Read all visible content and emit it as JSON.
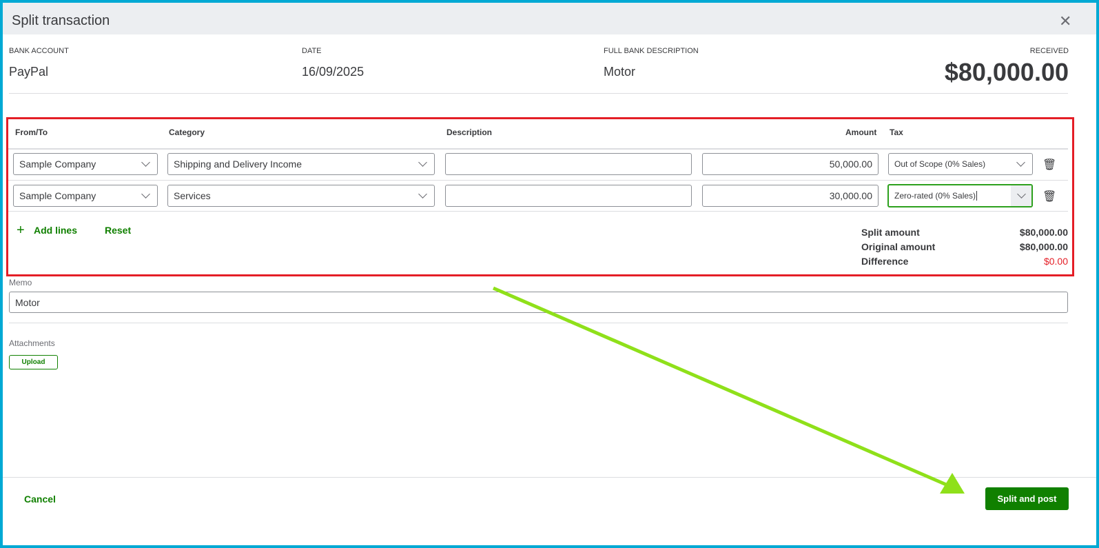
{
  "dialog": {
    "title": "Split transaction"
  },
  "info": {
    "bank_account_label": "BANK ACCOUNT",
    "bank_account": "PayPal",
    "date_label": "DATE",
    "date": "16/09/2025",
    "description_label": "FULL BANK DESCRIPTION",
    "description": "Motor",
    "received_label": "RECEIVED",
    "received": "$80,000.00"
  },
  "table": {
    "headers": {
      "from_to": "From/To",
      "category": "Category",
      "description": "Description",
      "amount": "Amount",
      "tax": "Tax"
    },
    "rows": [
      {
        "from_to": "Sample Company",
        "category": "Shipping and Delivery Income",
        "description": "",
        "amount": "50,000.00",
        "tax": "Out of Scope (0% Sales)"
      },
      {
        "from_to": "Sample Company",
        "category": "Services",
        "description": "",
        "amount": "30,000.00",
        "tax": "Zero-rated (0% Sales)"
      }
    ],
    "add_lines": "Add lines",
    "reset": "Reset"
  },
  "summary": {
    "split_label": "Split amount",
    "split": "$80,000.00",
    "original_label": "Original amount",
    "original": "$80,000.00",
    "difference_label": "Difference",
    "difference": "$0.00"
  },
  "memo": {
    "label": "Memo",
    "value": "Motor"
  },
  "attachments": {
    "label": "Attachments",
    "upload": "Upload"
  },
  "footer": {
    "cancel": "Cancel",
    "split_post": "Split and post"
  },
  "colors": {
    "accent": "#108000",
    "highlight_box": "#e41e26",
    "frame": "#00a9d4",
    "arrow": "#8fe01a",
    "difference": "#e41e26"
  }
}
